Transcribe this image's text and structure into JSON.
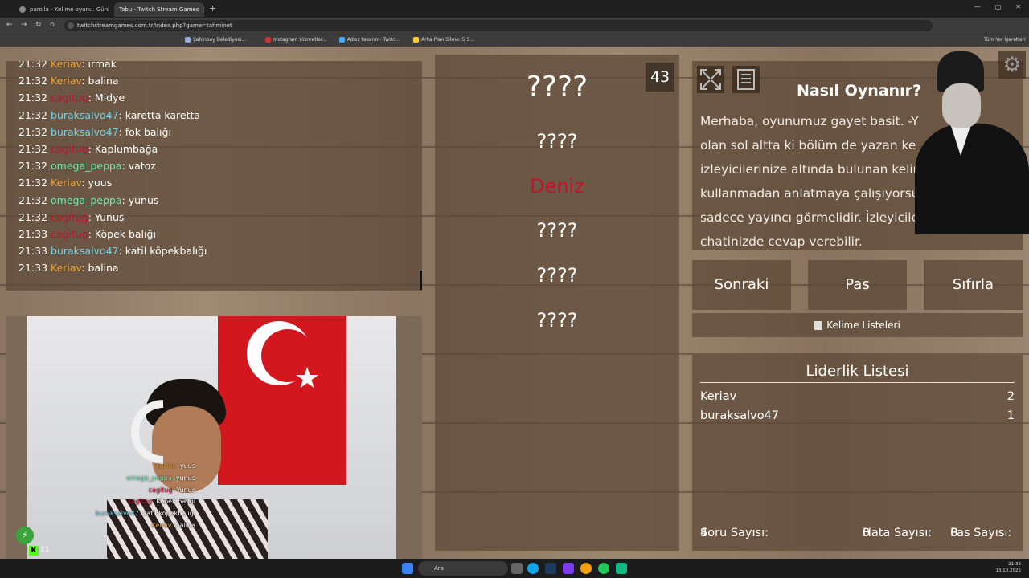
{
  "browser": {
    "tabs": [
      {
        "title": "parolla - Kelime oyunu. Günlük...",
        "active": false
      },
      {
        "title": "Tabu - Twitch Stream Games",
        "active": true
      }
    ],
    "url": "twitchstreamgames.com.tr/index.php?game=tahminet",
    "bookmarks": [
      "Şahinbey Belediyesi...",
      "Instagram Hizmetler...",
      "Adsız tasarım- Twitc...",
      "Arka Plan Silme: 5 S..."
    ],
    "bookmarks_right": "Tüm Yer İşaretleri"
  },
  "chat": {
    "messages": [
      {
        "time": "21:32",
        "user": "Keriav",
        "color": "#e8a33a",
        "text": "ırmak"
      },
      {
        "time": "21:32",
        "user": "Keriav",
        "color": "#e8a33a",
        "text": "balina"
      },
      {
        "time": "21:32",
        "user": "cagitug",
        "color": "#c8102e",
        "text": "Midye"
      },
      {
        "time": "21:32",
        "user": "buraksalvo47",
        "color": "#6ed4e8",
        "text": "karetta karetta"
      },
      {
        "time": "21:32",
        "user": "buraksalvo47",
        "color": "#6ed4e8",
        "text": "fok balığı"
      },
      {
        "time": "21:32",
        "user": "cagitug",
        "color": "#c8102e",
        "text": "Kaplumbağa"
      },
      {
        "time": "21:32",
        "user": "omega_peppa",
        "color": "#6ee8b0",
        "text": "vatoz"
      },
      {
        "time": "21:32",
        "user": "Keriav",
        "color": "#e8a33a",
        "text": "yuus"
      },
      {
        "time": "21:32",
        "user": "omega_peppa",
        "color": "#6ee8b0",
        "text": "yunus"
      },
      {
        "time": "21:32",
        "user": "cagitug",
        "color": "#c8102e",
        "text": "Yunus"
      },
      {
        "time": "21:33",
        "user": "cagitug",
        "color": "#c8102e",
        "text": "Köpek balığı"
      },
      {
        "time": "21:33",
        "user": "buraksalvo47",
        "color": "#6ed4e8",
        "text": "katil köpekbalığı"
      },
      {
        "time": "21:33",
        "user": "Keriav",
        "color": "#e8a33a",
        "text": "balina"
      }
    ]
  },
  "webcam_overlay": {
    "lines": [
      {
        "user": "Keriav",
        "color": "#e8a33a",
        "text": "yuus"
      },
      {
        "user": "omega_peppa",
        "color": "#6ee8b0",
        "text": "yunus"
      },
      {
        "user": "cagitug",
        "color": "#c8102e",
        "text": "Yunus"
      },
      {
        "user": "cagitug",
        "color": "#c8102e",
        "text": "Köpek balığı"
      },
      {
        "user": "buraksalvo47",
        "color": "#6ed4e8",
        "text": "katil köpekbalığı"
      },
      {
        "user": "Keriav",
        "color": "#e8a33a",
        "text": "balina"
      }
    ],
    "kick_logo": "K",
    "viewer_count": "11"
  },
  "game": {
    "counter": "43",
    "words": [
      {
        "text": "????",
        "state": "hidden"
      },
      {
        "text": "????",
        "state": "hidden"
      },
      {
        "text": "Deniz",
        "state": "active"
      },
      {
        "text": "????",
        "state": "hidden"
      },
      {
        "text": "????",
        "state": "hidden"
      },
      {
        "text": "????",
        "state": "hidden"
      }
    ]
  },
  "info": {
    "title": "Nasıl Oynanır?",
    "lines": [
      "Merhaba, oyunumuz gayet basit. -Y",
      "olan sol altta ki bölüm de yazan ke",
      "izleyicilerinize altında bulunan kelir",
      "kullanmadan anlatmaya çalışıyorsur",
      "sadece yayıncı görmelidir. İzleyicileriniz yayın",
      "chatinizde cevap verebilir."
    ]
  },
  "controls": {
    "next_label": "Sonraki",
    "pass_label": "Pas",
    "reset_label": "Sıfırla",
    "lists_label": "Kelime Listeleri"
  },
  "leaderboard": {
    "title": "Liderlik Listesi",
    "rows": [
      {
        "name": "Keriav",
        "score": "2"
      },
      {
        "name": "buraksalvo47",
        "score": "1"
      }
    ],
    "stats": {
      "questions_label": "Soru Sayısı:",
      "questions": "4",
      "errors_label": "Hata Sayısı:",
      "errors": "0",
      "passes_label": "Pas Sayısı:",
      "passes": "6"
    }
  },
  "taskbar": {
    "search_placeholder": "Ara",
    "time": "21:33",
    "date": "13.10.2025"
  }
}
